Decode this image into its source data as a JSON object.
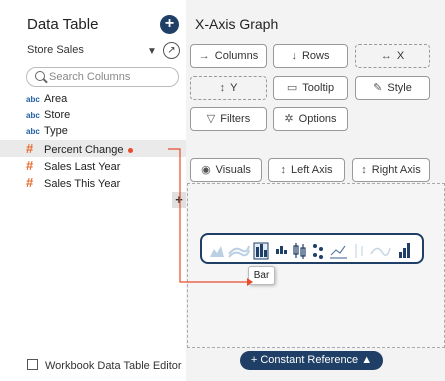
{
  "left": {
    "title": "Data Table",
    "add_label": "+",
    "table_name": "Store Sales",
    "search_placeholder": "Search Columns",
    "columns": [
      {
        "type": "abc",
        "name": "Area"
      },
      {
        "type": "abc",
        "name": "Store"
      },
      {
        "type": "abc",
        "name": "Type"
      },
      {
        "type": "#",
        "name": "Percent Change"
      },
      {
        "type": "#",
        "name": "Sales Last Year"
      },
      {
        "type": "#",
        "name": "Sales This Year"
      }
    ],
    "footer": "Workbook Data Table Editor"
  },
  "right": {
    "title": "X-Axis Graph",
    "buttons": {
      "columns": "Columns",
      "rows": "Rows",
      "x": "X",
      "y": "Y",
      "tooltip": "Tooltip",
      "style": "Style",
      "filters": "Filters",
      "options": "Options",
      "visuals": "Visuals",
      "left_axis": "Left Axis",
      "right_axis": "Right Axis"
    },
    "plus_tab": "+",
    "tooltip_text": "Bar",
    "constant_reference": "Constant Reference"
  },
  "colors": {
    "accent": "#1f3f66",
    "number_type": "#e66a2c",
    "text_type": "#1f5fa8",
    "drag_line": "#e84c2c"
  },
  "icons": [
    "search-icon",
    "link-icon",
    "arrow-right-icon",
    "arrow-down-icon",
    "arrow-horizontal-icon",
    "arrow-vertical-icon",
    "tooltip-icon",
    "style-icon",
    "filter-icon",
    "gear-icon",
    "eye-icon",
    "edit-icon"
  ]
}
